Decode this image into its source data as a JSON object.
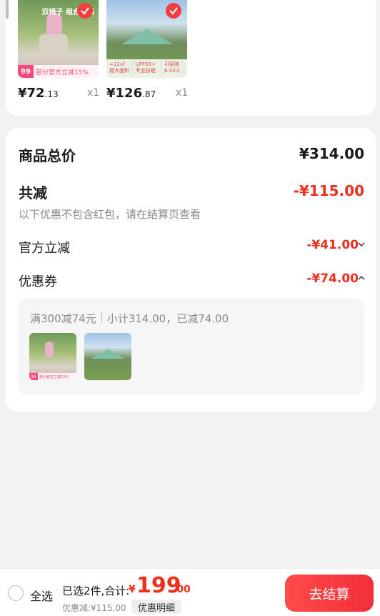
{
  "products": [
    {
      "price_main": "¥72",
      "price_cents": ".13",
      "qty": "x1",
      "badge": "99",
      "promo": "部分官方立减15%",
      "overlay": "双椅子 组合套装"
    },
    {
      "price_main": "¥126",
      "price_cents": ".87",
      "qty": "x1",
      "feature1": "≈12㎡ 超大面积",
      "feature2": "UPF50+ 专业防晒",
      "feature3": "可容纳8-10人"
    }
  ],
  "summary": {
    "total_label": "商品总价",
    "total_value": "¥314.00",
    "discount_label": "共减",
    "discount_value": "-¥115.00",
    "discount_note": "以下优惠不包含红包，请在结算页查看",
    "official_label": "官方立减",
    "official_value": "-¥41.00",
    "coupon_label": "优惠券",
    "coupon_value": "-¥74.00",
    "coupon_desc": "满300减74元｜小计314.00，已减74.00"
  },
  "bottom": {
    "select_all": "全选",
    "selected_info": "已选2件,合计:",
    "currency": "¥",
    "total_big": "199",
    "total_cents": ".00",
    "saved": "优惠减:¥115.00",
    "detail_button": "优惠明细",
    "checkout_button": "去结算"
  },
  "colors": {
    "accent": "#f0301f",
    "checkout_start": "#ff4b49",
    "checkout_end": "#f22e3a"
  }
}
